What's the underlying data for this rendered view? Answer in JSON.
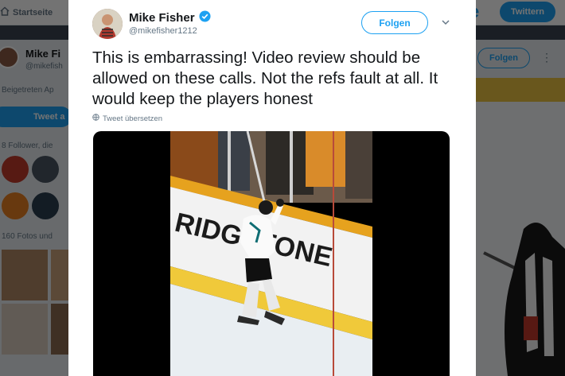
{
  "background": {
    "topbar": {
      "home_label": "Startseite",
      "tweet_button": "Twittern"
    },
    "profile": {
      "name": "Mike Fi",
      "handle": "@mikefish",
      "joined": "Beigetreten Ap",
      "tweet_to": "Tweet a",
      "followers": "8 Follower, die",
      "photos": "160 Fotos und",
      "follow_button": "Folgen"
    }
  },
  "tweet": {
    "author_name": "Mike Fisher",
    "author_handle": "@mikefisher1212",
    "follow_button": "Folgen",
    "text": "This is embarrassing! Video review should be allowed on these calls. Not the refs fault at all. It would keep the players honest",
    "translate_label": "Tweet übersetzen",
    "video_board_text": "RIDGSTONE"
  },
  "colors": {
    "accent": "#1da1f2",
    "text": "#14171a",
    "secondary": "#657786"
  },
  "icons": [
    "home-icon",
    "verified-badge-icon",
    "chevron-down-icon",
    "globe-icon",
    "more-icon"
  ]
}
